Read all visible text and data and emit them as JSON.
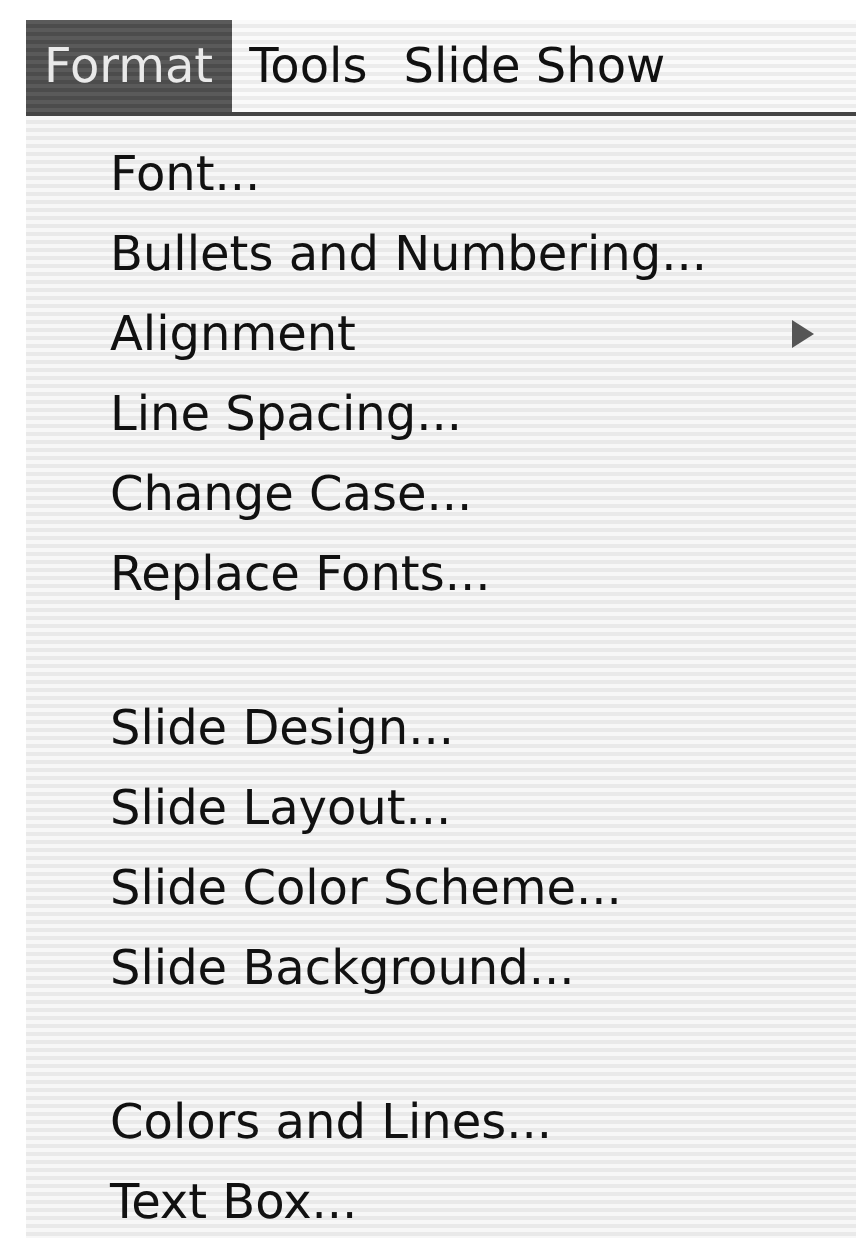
{
  "menu_bar": [
    {
      "label": "Format",
      "selected": true
    },
    {
      "label": "Tools",
      "selected": false
    },
    {
      "label": "Slide Show",
      "selected": false
    }
  ],
  "menu": {
    "items": [
      {
        "kind": "item",
        "label": "Font...",
        "submenu": false
      },
      {
        "kind": "item",
        "label": "Bullets and Numbering...",
        "submenu": false
      },
      {
        "kind": "item",
        "label": "Alignment",
        "submenu": true
      },
      {
        "kind": "item",
        "label": "Line Spacing...",
        "submenu": false
      },
      {
        "kind": "item",
        "label": "Change Case...",
        "submenu": false
      },
      {
        "kind": "item",
        "label": "Replace Fonts...",
        "submenu": false
      },
      {
        "kind": "separator"
      },
      {
        "kind": "item",
        "label": "Slide Design...",
        "submenu": false
      },
      {
        "kind": "item",
        "label": "Slide Layout...",
        "submenu": false
      },
      {
        "kind": "item",
        "label": "Slide Color Scheme...",
        "submenu": false
      },
      {
        "kind": "item",
        "label": "Slide Background...",
        "submenu": false
      },
      {
        "kind": "separator"
      },
      {
        "kind": "item",
        "label": "Colors and Lines...",
        "submenu": false
      },
      {
        "kind": "item",
        "label": "Text Box...",
        "submenu": false
      }
    ]
  }
}
